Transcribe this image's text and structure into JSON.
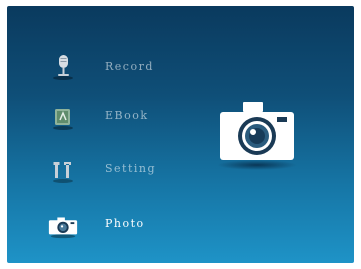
{
  "menu": {
    "items": [
      {
        "label": "Record",
        "icon": "microphone-icon"
      },
      {
        "label": "EBook",
        "icon": "ebook-icon"
      },
      {
        "label": "Setting",
        "icon": "tools-icon"
      },
      {
        "label": "Photo",
        "icon": "camera-icon"
      }
    ],
    "selected": "Photo"
  },
  "preview": {
    "icon": "camera-icon"
  },
  "colors": {
    "bg_top": "#0a3a5e",
    "bg_bottom": "#1e93c7",
    "label_inactive": "rgba(255,255,255,0.55)",
    "label_active": "#ffffff"
  }
}
